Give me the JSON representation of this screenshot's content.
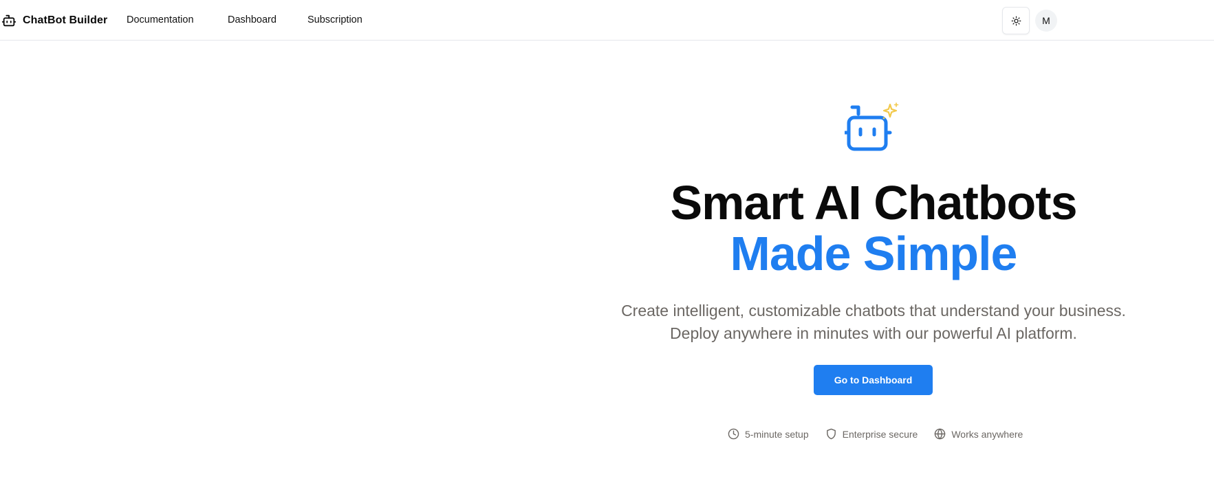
{
  "brand": {
    "name": "ChatBot Builder",
    "icon": "bot-icon"
  },
  "nav": {
    "links": [
      {
        "label": "Documentation"
      },
      {
        "label": "Dashboard"
      },
      {
        "label": "Subscription"
      }
    ],
    "theme_toggle_icon": "sun-icon",
    "avatar_initial": "M"
  },
  "hero": {
    "icon": "bot-sparkle-icon",
    "title_line1": "Smart AI Chatbots",
    "title_line2": "Made Simple",
    "subtitle_line1": "Create intelligent, customizable chatbots that understand your business.",
    "subtitle_line2": "Deploy anywhere in minutes with our powerful AI platform.",
    "cta_label": "Go to Dashboard"
  },
  "features": [
    {
      "icon": "clock-icon",
      "label": "5-minute setup"
    },
    {
      "icon": "shield-icon",
      "label": "Enterprise secure"
    },
    {
      "icon": "globe-icon",
      "label": "Works anywhere"
    }
  ],
  "colors": {
    "accent": "#1f7ef0",
    "sparkle": "#f2c94c",
    "muted_text": "#6b6763",
    "border": "#e5e7eb"
  }
}
